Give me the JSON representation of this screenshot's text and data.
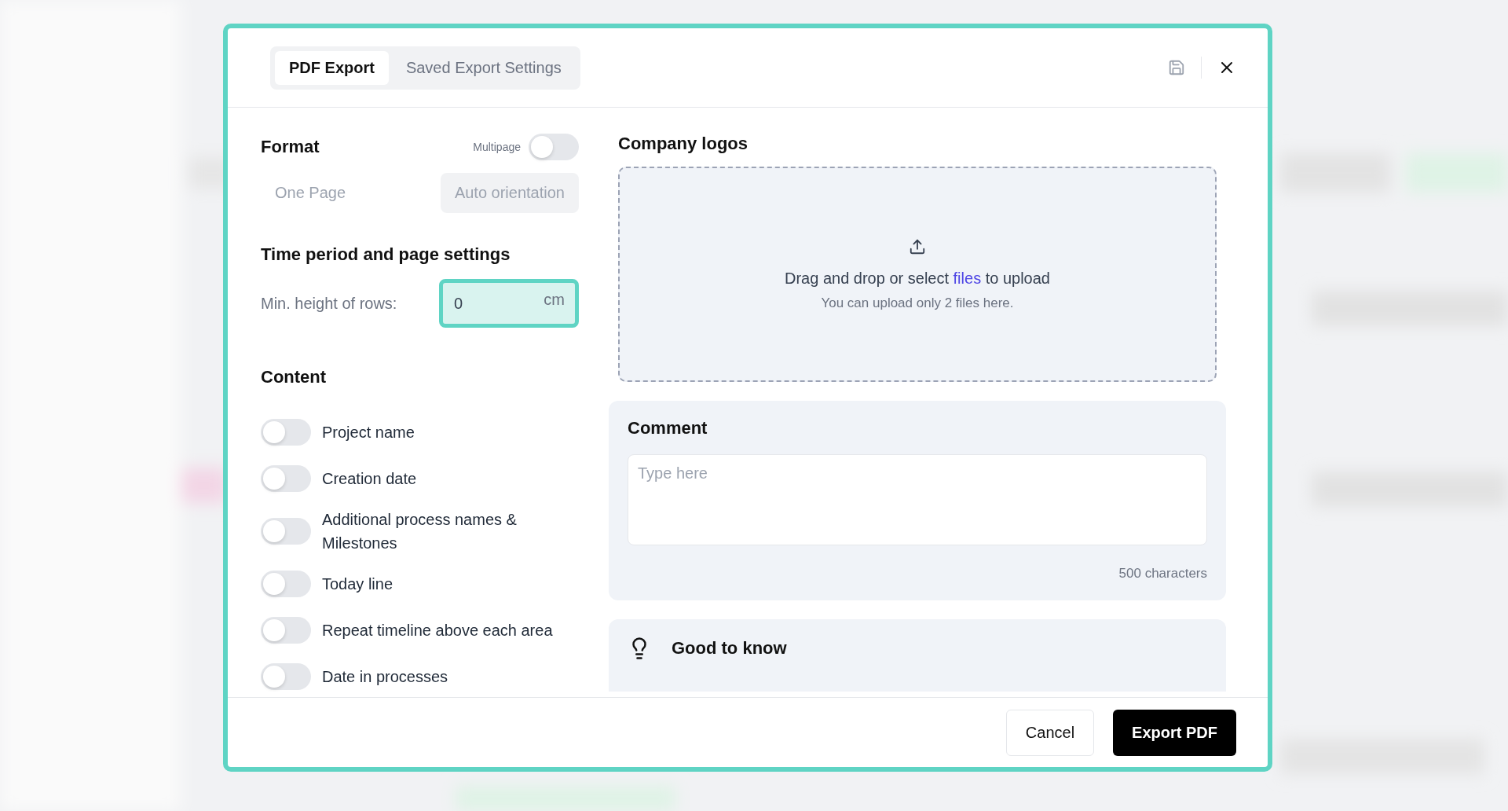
{
  "dialog": {
    "tabs": [
      {
        "label": "PDF Export",
        "selected": true
      },
      {
        "label": "Saved Export Settings",
        "selected": false
      }
    ]
  },
  "format": {
    "title": "Format",
    "multipage": {
      "label": "Multipage",
      "on": false
    },
    "options": [
      {
        "label": "One Page",
        "selected": false
      },
      {
        "label": "Auto orientation",
        "selected": true
      }
    ]
  },
  "time_period": {
    "title": "Time period and page settings",
    "min_height": {
      "label": "Min. height of rows:",
      "value": "0",
      "unit": "cm",
      "focused": true
    }
  },
  "content": {
    "title": "Content",
    "toggles": [
      {
        "label": "Project name",
        "on": false
      },
      {
        "label": "Creation date",
        "on": false
      },
      {
        "label": "Additional process names & Milestones",
        "on": false
      },
      {
        "label": "Today line",
        "on": false
      },
      {
        "label": "Repeat timeline above each area",
        "on": false
      },
      {
        "label": "Date in processes",
        "on": false
      }
    ]
  },
  "logos": {
    "title": "Company logos",
    "prompt_before": "Drag and drop or select ",
    "link": "files",
    "prompt_after": " to upload",
    "hint": "You can upload only 2 files here."
  },
  "comment": {
    "title": "Comment",
    "placeholder": "Type here",
    "counter": "500 characters"
  },
  "tip": {
    "title": "Good to know"
  },
  "footer": {
    "cancel": "Cancel",
    "export": "Export PDF"
  }
}
